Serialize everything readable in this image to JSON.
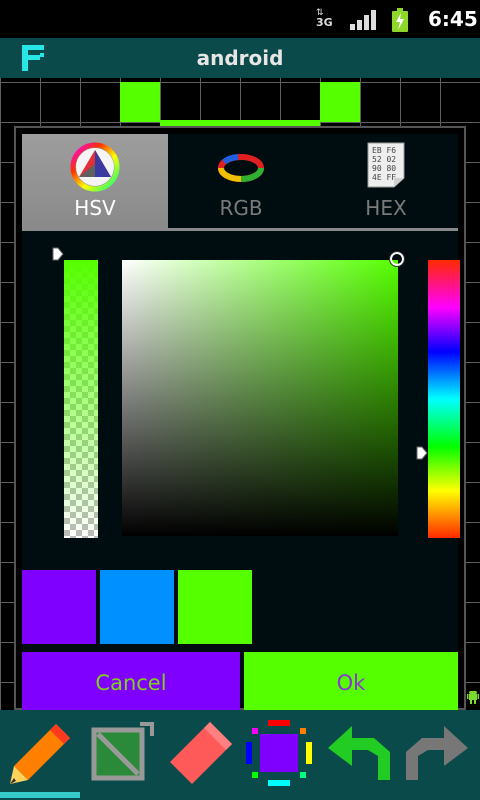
{
  "status_bar": {
    "network": "3G",
    "time": "6:45"
  },
  "app": {
    "title": "android",
    "logo_icon": "app-logo-icon"
  },
  "canvas": {
    "filled_color": "#55ff00",
    "grid_color": "#5f5f5f"
  },
  "color_picker": {
    "tabs": [
      {
        "label": "HSV",
        "icon": "hsv-wheel-icon",
        "active": true
      },
      {
        "label": "RGB",
        "icon": "rgb-rings-icon",
        "active": false
      },
      {
        "label": "HEX",
        "icon": "hex-table-icon",
        "active": false
      }
    ],
    "hex_icon_text": [
      "EB F6",
      "52 02",
      "90 80",
      "4E FF"
    ],
    "selected_hue_color": "#55ff00",
    "recent_colors": [
      "#7f00ff",
      "#0090ff",
      "#55ff00"
    ],
    "cancel_label": "Cancel",
    "ok_label": "Ok",
    "cancel_color": "#7f00ff",
    "ok_color": "#55ff00"
  },
  "toolbar": {
    "tools": [
      "pencil-icon",
      "fill-bucket-icon",
      "eraser-icon",
      "color-picker-icon",
      "undo-icon",
      "redo-icon"
    ]
  }
}
